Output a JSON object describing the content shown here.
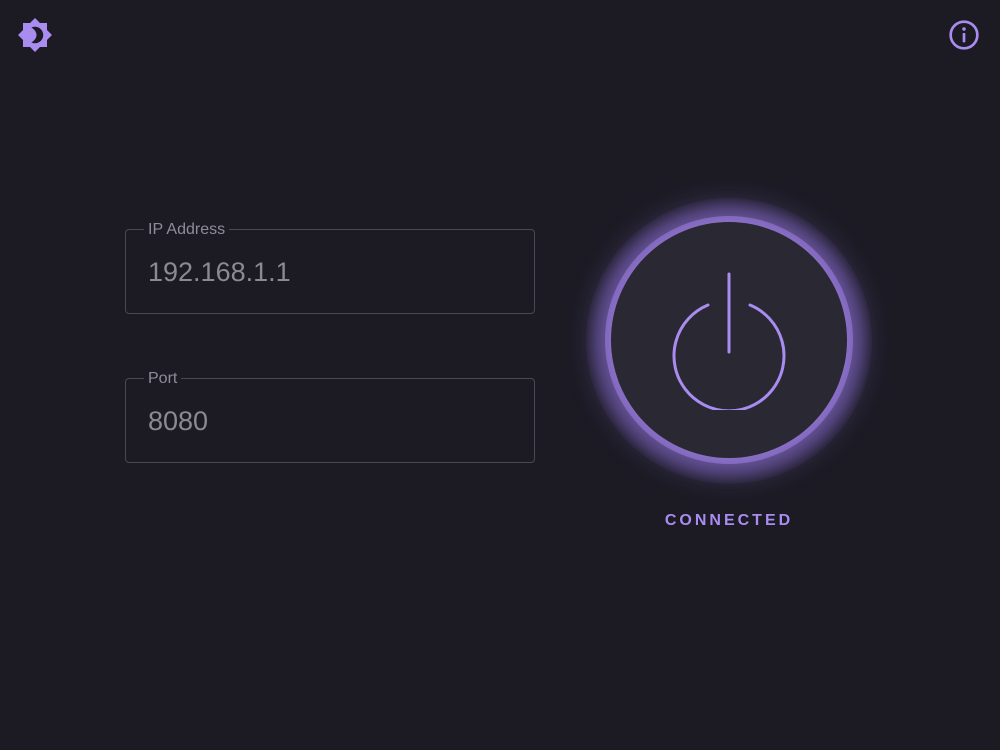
{
  "header": {
    "theme_icon": "brightness-icon",
    "info_icon": "info-icon"
  },
  "form": {
    "ip": {
      "label": "IP Address",
      "value": "192.168.1.1"
    },
    "port": {
      "label": "Port",
      "value": "8080"
    }
  },
  "connection": {
    "power_icon": "power-icon",
    "status": "CONNECTED"
  },
  "colors": {
    "background": "#1c1b24",
    "accent": "#a98cf0",
    "button": "#2a2832",
    "field_border": "#4a4853",
    "text_muted": "#8e8c96"
  }
}
